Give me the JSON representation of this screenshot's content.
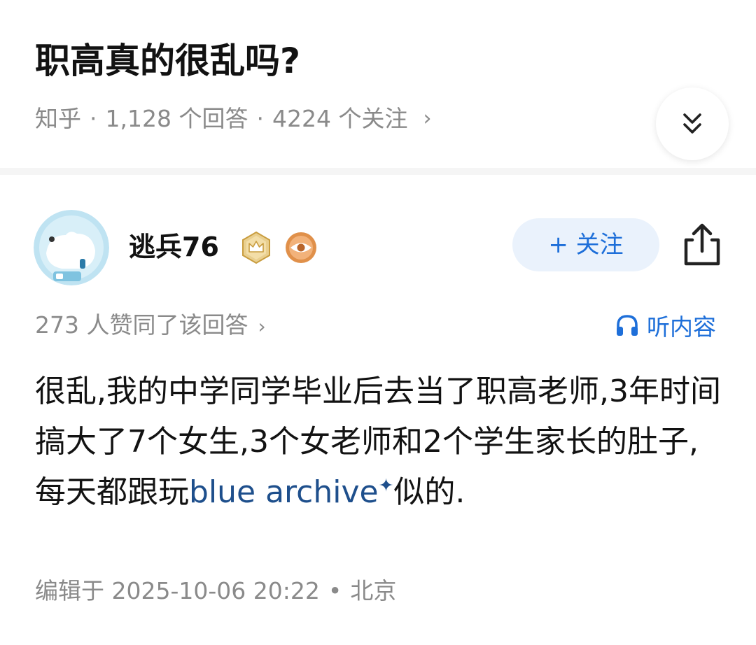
{
  "question": {
    "title": "职高真的很乱吗?",
    "source": "知乎",
    "separator": "·",
    "answers_count": "1,128 个回答",
    "followers_count": "4224 个关注",
    "more_chevron": "›",
    "expand_icon": "double-chevron-down-icon"
  },
  "answer": {
    "author": {
      "name": "逃兵76",
      "badges": [
        "crown-badge-icon",
        "eye-badge-icon"
      ]
    },
    "follow_label": "+ 关注",
    "share_icon": "share-icon",
    "upvote_text": "273 人赞同了该回答",
    "upvote_chevron": "›",
    "listen_label": "听内容",
    "listen_icon": "headphones-icon",
    "content_before": "很乱,我的中学同学毕业后去当了职高老师,3年时间搞大了7个女生,3个女老师和2个学生家长的肚子,每天都跟玩",
    "content_keyword": "blue archive",
    "content_keyword_mark": "✦",
    "content_after": "似的.",
    "edited_label": "编辑于 2025-10-06 20:22",
    "edit_separator": "•",
    "location": "北京"
  },
  "colors": {
    "accent": "#1e6fd9",
    "follow_bg": "#eaf2fc",
    "meta_text": "#8a8a8a",
    "keyword": "#1e4f8c",
    "badge_gold": "#d9b35c",
    "badge_orange": "#e0904a"
  }
}
